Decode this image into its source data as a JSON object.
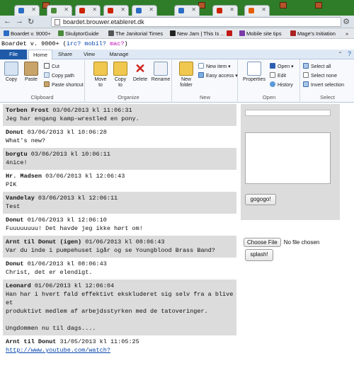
{
  "browser": {
    "url": "boardet.brouwer.etableret.dk",
    "tabs": [
      {
        "favicon_color": "#2b6cc4"
      },
      {
        "favicon_color": "#4a8b3a"
      },
      {
        "favicon_color": "#cc2200"
      },
      {
        "favicon_color": "#cc2200"
      },
      {
        "favicon_color": "#2b6cc4"
      },
      {
        "favicon_color": "#2b6cc4"
      },
      {
        "favicon_color": "#cc2200"
      },
      {
        "favicon_color": "#e45d00"
      }
    ],
    "bookmarks": [
      {
        "label": "Boardet v. 9000+",
        "icon_color": "#2b6cc4"
      },
      {
        "label": "SkulptorGuide",
        "icon_color": "#4a8b3a"
      },
      {
        "label": "The Janitorial Times",
        "icon_color": "#555555"
      },
      {
        "label": "New Jam | This Is ...",
        "icon_color": "#222222"
      },
      {
        "label": "",
        "icon_color": "#c01818"
      },
      {
        "label": "Mobile site tips",
        "icon_color": "#7a3aa8"
      },
      {
        "label": "Mage's Initiation",
        "icon_color": "#aa2222"
      },
      {
        "label": "»",
        "icon_color": ""
      }
    ]
  },
  "site": {
    "title_main": "Boardet v. 9000+ (",
    "link_irc": "irc?",
    "link_mobil": "mobil?",
    "link_mac": "mac?",
    "title_end": ")"
  },
  "ribbon": {
    "tabs": [
      "File",
      "Home",
      "Share",
      "View",
      "Manage"
    ],
    "groups": {
      "clipboard": "Clipboard",
      "organize": "Organize",
      "new": "New",
      "open": "Open",
      "select": "Select"
    },
    "buttons": {
      "copy": "Copy",
      "paste": "Paste",
      "cut": "Cut",
      "copy_path": "Copy path",
      "paste_shortcut": "Paste shortcut",
      "move_to": "Move to",
      "copy_to": "Copy to",
      "delete": "Delete",
      "rename": "Rename",
      "new_folder": "New folder",
      "new_item": "New item ▾",
      "easy_access": "Easy access ▾",
      "properties": "Properties",
      "open": "Open ▾",
      "edit": "Edit",
      "history": "History",
      "select_all": "Select all",
      "select_none": "Select none",
      "invert_selection": "Invert selection"
    }
  },
  "posts": [
    {
      "nick": "Torben Frost",
      "time": "03/06/2013 kl 11:06:31",
      "text": "Jeg har engang kamp-wrestled en pony."
    },
    {
      "nick": "Donut",
      "time": "03/06/2013 kl 10:06:28",
      "text": "What's new?"
    },
    {
      "nick": "borgtu",
      "time": "03/06/2013 kl 10:06:11",
      "text": "4nice!"
    },
    {
      "nick": "Hr. Madsen",
      "time": "03/06/2013 kl 12:06:43",
      "text": "PIK"
    },
    {
      "nick": "Vandelay",
      "time": "03/06/2013 kl 12:06:11",
      "text": "Test"
    },
    {
      "nick": "Donut",
      "time": "01/06/2013 kl 12:06:10",
      "text": "Fuuuuuuuu! Det havde jeg ikke hørt om!"
    },
    {
      "nick": "Arnt til Donut (igen)",
      "time": "01/06/2013 kl 08:06:43",
      "text": "Var du inde i pumpehuset igår og se Youngblood Brass Band?"
    },
    {
      "nick": "Donut",
      "time": "01/06/2013 kl 08:06:43",
      "text": "Christ, det er elendigt."
    },
    {
      "nick": "Leonard",
      "time": "01/06/2013 kl 12:06:04",
      "text": "Han har i hvert fald effektivt ekskluderet sig selv fra a blive et\nproduktivt medlem af arbejdsstyrken med de tatoveringer.\n\nUngdommen nu til dags...."
    },
    {
      "nick": "Arnt til Donut",
      "time": "31/05/2013 kl 11:05:25",
      "link": "http://www.youtube.com/watch?"
    }
  ],
  "form": {
    "submit_label": "gogogo!",
    "choose_file_label": "Choose File",
    "no_file_text": "No file chosen",
    "splash_label": "splash!"
  }
}
